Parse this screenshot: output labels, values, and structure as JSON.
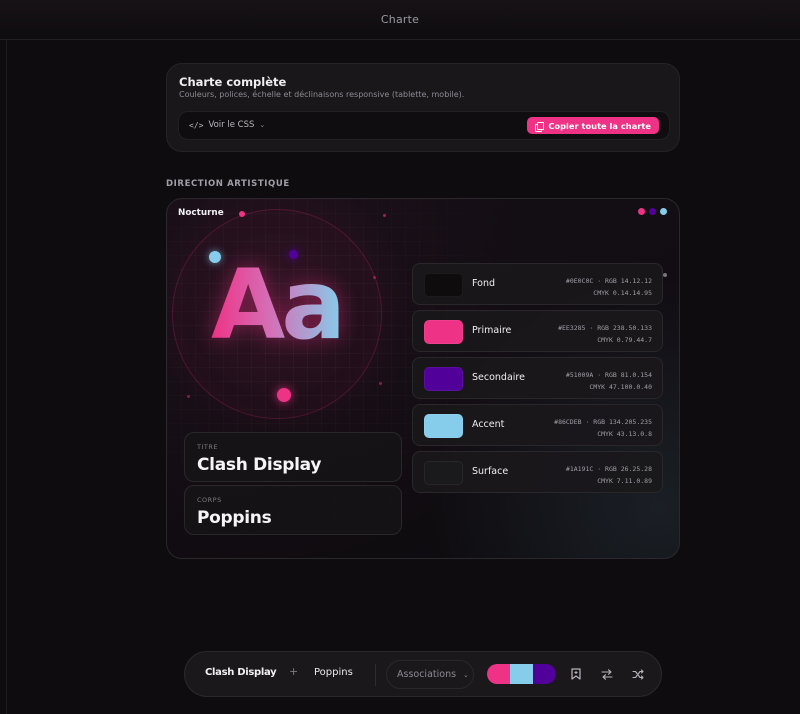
{
  "header": {
    "title": "Charte"
  },
  "charte": {
    "title": "Charte complète",
    "subtitle": "Couleurs, polices, échelle et déclinaisons responsive (tablette, mobile).",
    "view_css": "Voir le CSS",
    "copy_label": "Copier toute la charte"
  },
  "art": {
    "section_label": "DIRECTION ARTISTIQUE",
    "theme_name": "Nocturne",
    "glyph": "Aa",
    "theme_dots": [
      "#ee3285",
      "#51009a",
      "#86cdeb"
    ],
    "fonts": {
      "title_label": "TITRE",
      "title_value": "Clash Display",
      "body_label": "CORPS",
      "body_value": "Poppins"
    },
    "swatches": [
      {
        "name": "Fond",
        "hex": "#0E0C0C",
        "line1": "#0E0C0C · RGB 14.12.12",
        "line2": "CMYK 0.14.14.95"
      },
      {
        "name": "Primaire",
        "hex": "#EE3285",
        "line1": "#EE3285 · RGB 238.50.133",
        "line2": "CMYK 0.79.44.7"
      },
      {
        "name": "Secondaire",
        "hex": "#51009A",
        "line1": "#51009A · RGB 81.0.154",
        "line2": "CMYK 47.100.0.40"
      },
      {
        "name": "Accent",
        "hex": "#86CDEB",
        "line1": "#86CDEB · RGB 134.205.235",
        "line2": "CMYK 43.13.0.8"
      },
      {
        "name": "Surface",
        "hex": "#1A191C",
        "line1": "#1A191C · RGB 26.25.28",
        "line2": "CMYK 7.11.0.89"
      }
    ]
  },
  "toolbar": {
    "title_font": "Clash Display",
    "plus": "+",
    "body_font": "Poppins",
    "associations": "Associations",
    "palette": [
      "#ee3285",
      "#86cdeb",
      "#51009a"
    ]
  }
}
